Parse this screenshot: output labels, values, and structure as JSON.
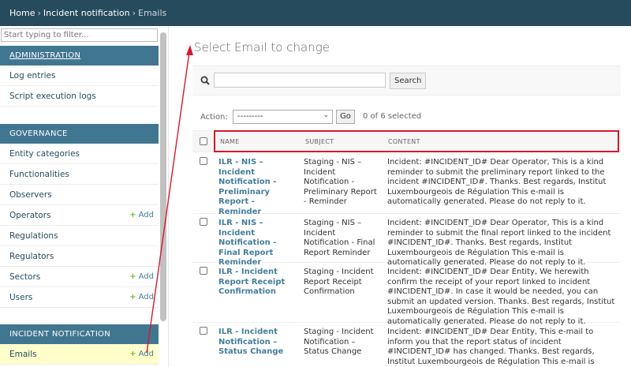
{
  "breadcrumb": {
    "home": "Home",
    "section": "Incident notification",
    "current": "Emails",
    "sep": "›"
  },
  "sidebar": {
    "filter_placeholder": "Start typing to filter...",
    "add_label": "Add",
    "modules": [
      {
        "title": "ADMINISTRATION",
        "items": [
          {
            "label": "Log entries",
            "add": false
          },
          {
            "label": "Script execution logs",
            "add": false
          }
        ]
      },
      {
        "title": "GOVERNANCE",
        "items": [
          {
            "label": "Entity categories",
            "add": false
          },
          {
            "label": "Functionalities",
            "add": false
          },
          {
            "label": "Observers",
            "add": false
          },
          {
            "label": "Operators",
            "add": true
          },
          {
            "label": "Regulations",
            "add": false
          },
          {
            "label": "Regulators",
            "add": false
          },
          {
            "label": "Sectors",
            "add": true
          },
          {
            "label": "Users",
            "add": true
          }
        ]
      },
      {
        "title": "INCIDENT NOTIFICATION",
        "items": [
          {
            "label": "Emails",
            "add": true
          }
        ]
      }
    ]
  },
  "main": {
    "title": "Select Email to change",
    "search_button": "Search",
    "action_label": "Action:",
    "action_selected": "---------",
    "go_button": "Go",
    "selected_count": "0 of 6 selected",
    "columns": [
      "NAME",
      "SUBJECT",
      "CONTENT"
    ],
    "rows": [
      {
        "name": "ILR - NIS – Incident Notification - Preliminary Report - Reminder",
        "subject": "Staging - NIS – Incident Notification - Preliminary Report - Reminder",
        "content": "Incident: #INCIDENT_ID# Dear Operator, This is a kind reminder to submit the preliminary report linked to the incident #INCIDENT_ID#. Thanks. Best regards, Institut Luxembourgeois de Régulation This e-mail is automatically generated. Please do not reply to it."
      },
      {
        "name": "ILR - NIS – Incident Notification - Final Report Reminder",
        "subject": "Staging - NIS – Incident Notification - Final Report Reminder",
        "content": "Incident: #INCIDENT_ID# Dear Operator, This is a kind reminder to submit the final report linked to the incident #INCIDENT_ID#. Thanks. Best regards, Institut Luxembourgeois de Régulation This e-mail is automatically generated. Please do not reply to it."
      },
      {
        "name": "ILR - Incident Report Receipt Confirmation",
        "subject": "Staging - Incident Report Receipt Confirmation",
        "content": "Incident: #INCIDENT_ID# Dear Entity, We herewith confirm the receipt of your report linked to incident #INCIDENT_ID#. In case it would be needed, you can submit an updated version. Thanks. Best regards, Institut Luxembourgeois de Régulation This e-mail is automatically generated. Please do not reply to it."
      },
      {
        "name": "ILR - Incident Notification – Status Change",
        "subject": "Staging - Incident Notification – Status Change",
        "content": "Incident: #INCIDENT_ID# Dear Entity, This e-mail to inform you that the report status of incident #INCIDENT_ID# has changed. Thanks. Best regards, Institut Luxembourgeois de Régulation This e-mail is automatically generated. Please do not reply to it."
      }
    ]
  },
  "colors": {
    "header_bg": "#264b5d",
    "module_bg": "#417690",
    "link": "#447e9b",
    "add_plus": "#70bf2b",
    "active_row": "#ffffcc",
    "highlight": "#d6192b"
  }
}
